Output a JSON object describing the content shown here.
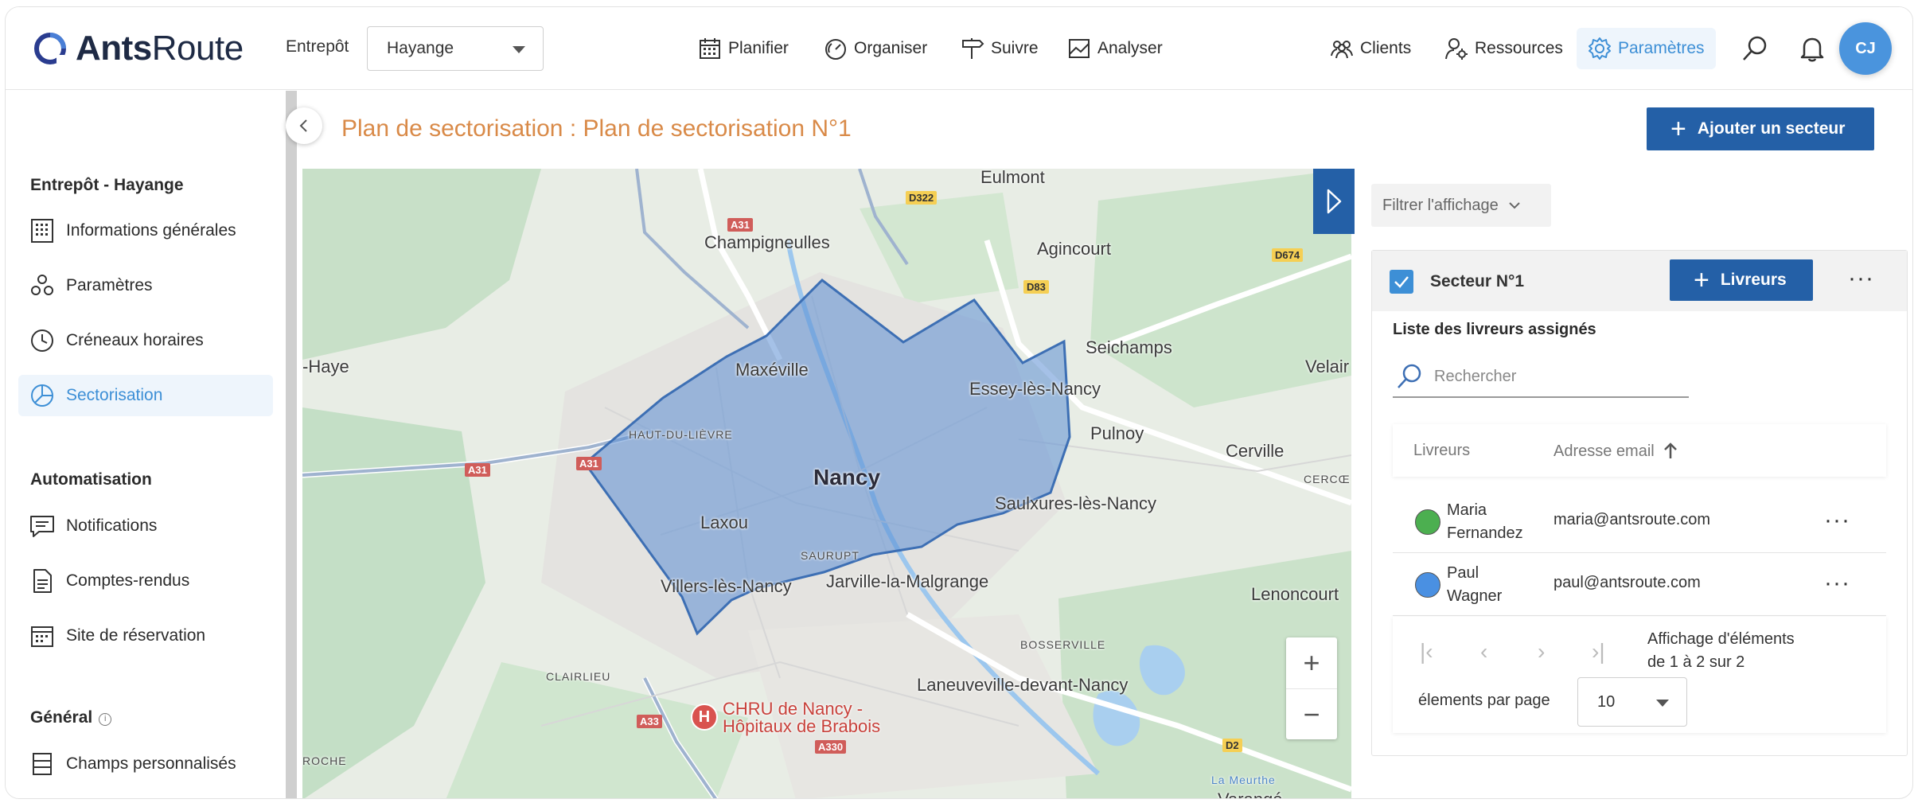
{
  "app": {
    "logo_bold": "Ants",
    "logo_light": "Route"
  },
  "header": {
    "warehouse_label": "Entrepôt",
    "warehouse_value": "Hayange",
    "nav": {
      "plan": "Planifier",
      "organize": "Organiser",
      "follow": "Suivre",
      "analyze": "Analyser",
      "clients": "Clients",
      "resources": "Ressources",
      "settings": "Paramètres"
    },
    "avatar_initials": "CJ"
  },
  "sidebar": {
    "section_warehouse": "Entrepôt - Hayange",
    "items_warehouse": [
      "Informations générales",
      "Paramètres",
      "Créneaux horaires",
      "Sectorisation"
    ],
    "section_automation": "Automatisation",
    "items_automation": [
      "Notifications",
      "Comptes-rendus",
      "Site de réservation"
    ],
    "section_general": "Général",
    "items_general": [
      "Champs personnalisés"
    ]
  },
  "page": {
    "title": "Plan de sectorisation : Plan de sectorisation N°1",
    "add_sector_button": "Ajouter un secteur"
  },
  "map": {
    "labels": {
      "eulmont": "Eulmont",
      "champigneulles": "Champigneulles",
      "agincourt": "Agincourt",
      "seichamps": "Seichamps",
      "haye": "-Haye",
      "maxeville": "Maxéville",
      "essey": "Essey-lès-Nancy",
      "velaine": "Velair",
      "pulnoy": "Pulnoy",
      "haut_du_lievre": "HAUT-DU-LIÈVRE",
      "cerville": "Cerville",
      "cercueil": "CERCŒ",
      "nancy": "Nancy",
      "saulxures": "Saulxures-lès-Nancy",
      "laxou": "Laxou",
      "saurupt": "SAURUPT",
      "villers": "Villers-lès-Nancy",
      "jarville": "Jarville-la-Malgrange",
      "lenoncourt": "Lenoncourt",
      "bosserville": "BOSSERVILLE",
      "clairlieu": "CLAIRLIEU",
      "laneuveville": "Laneuveville-devant-Nancy",
      "chru_line1": "CHRU de Nancy -",
      "chru_line2": "Hôpitaux de Brabois",
      "roche": "ROCHE",
      "varangeville": "Varangé",
      "la_meurthe": "La Meurthe"
    },
    "roads": {
      "a31a": "A31",
      "a31b": "A31",
      "a31c": "A31",
      "a33": "A33",
      "a330": "A330",
      "d322": "D322",
      "d83": "D83",
      "d674": "D674",
      "d2": "D2"
    },
    "hospital_symbol": "H",
    "zoom_in": "+",
    "zoom_out": "−",
    "sector_color": "#5b8ed3"
  },
  "panel": {
    "filter_label": "Filtrer l'affichage",
    "sector_title": "Secteur N°1",
    "drivers_button": "Livreurs",
    "assigned_title": "Liste des livreurs assignés",
    "search_placeholder": "Rechercher",
    "columns": {
      "drivers": "Livreurs",
      "email": "Adresse email"
    },
    "rows": [
      {
        "first": "Maria",
        "last": "Fernandez",
        "email": "maria@antsroute.com",
        "color": "#4caf50"
      },
      {
        "first": "Paul",
        "last": "Wagner",
        "email": "paul@antsroute.com",
        "color": "#4a90e2"
      }
    ],
    "pagination": {
      "info_line1": "Affichage d'éléments",
      "info_line2": "de 1 à 2 sur 2",
      "per_page_label": "élements par page",
      "per_page_value": "10"
    }
  }
}
